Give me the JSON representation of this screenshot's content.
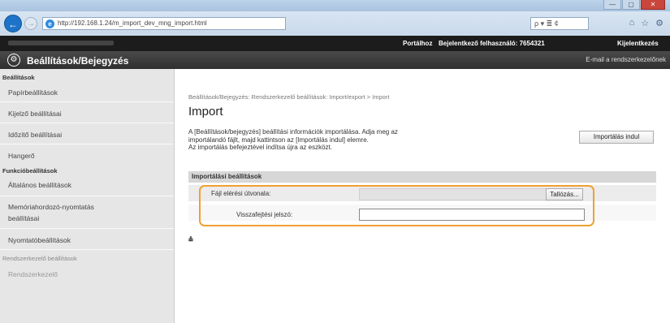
{
  "browser": {
    "url": "http://192.168.1.24/m_import_dev_mng_import.html",
    "search_placeholder": "ρ ▾ ≣ ¢",
    "controls": {
      "minimize": "—",
      "maximize": "▢",
      "close": "✕"
    }
  },
  "topnav": {
    "portal": "Portálhoz",
    "user": "Bejelentkező felhasználó: 7654321",
    "logout": "Kijelentkezés"
  },
  "header": {
    "title": "Beállítások/Bejegyzés",
    "mail_link": "E-mail a rendszerkezelőnek"
  },
  "sidebar": {
    "settings_head": "Beállítások",
    "items": [
      "Papírbeállítások",
      "Kijelző beállításai",
      "Időzítő beállításai",
      "Hangerő"
    ],
    "functions_head": "Funkcióbeállítások",
    "function_items": [
      "Általános beállítások",
      "Memóriahordozó-nyomtatás",
      "beállításai",
      "Nyomtatóbeállítások"
    ],
    "admin_head": "Rendszerkezelő beállítások",
    "admin_items": [
      "Rendszerkezelő"
    ]
  },
  "main": {
    "breadcrumb": "Beállítások/Bejegyzés: Rendszerkezelő beállítások: Import/export > Import",
    "title": "Import",
    "desc_lines": [
      "A [Beállítások/bejegyzés] beállítási információk importálása. Adja meg az",
      "importálandó fájlt, majd kattintson az [Importálás indul] elemre.",
      "Az importálás befejeztével indítsa újra az eszközt."
    ],
    "start_button": "Importálás indul",
    "section_title": "Importálási beállítások",
    "file_path_label": "Fájl elérési útvonala:",
    "browse_button": "Tallózás...",
    "password_label": "Visszafejtési jelszó:",
    "password_value": "",
    "top_icon": "⩮"
  }
}
